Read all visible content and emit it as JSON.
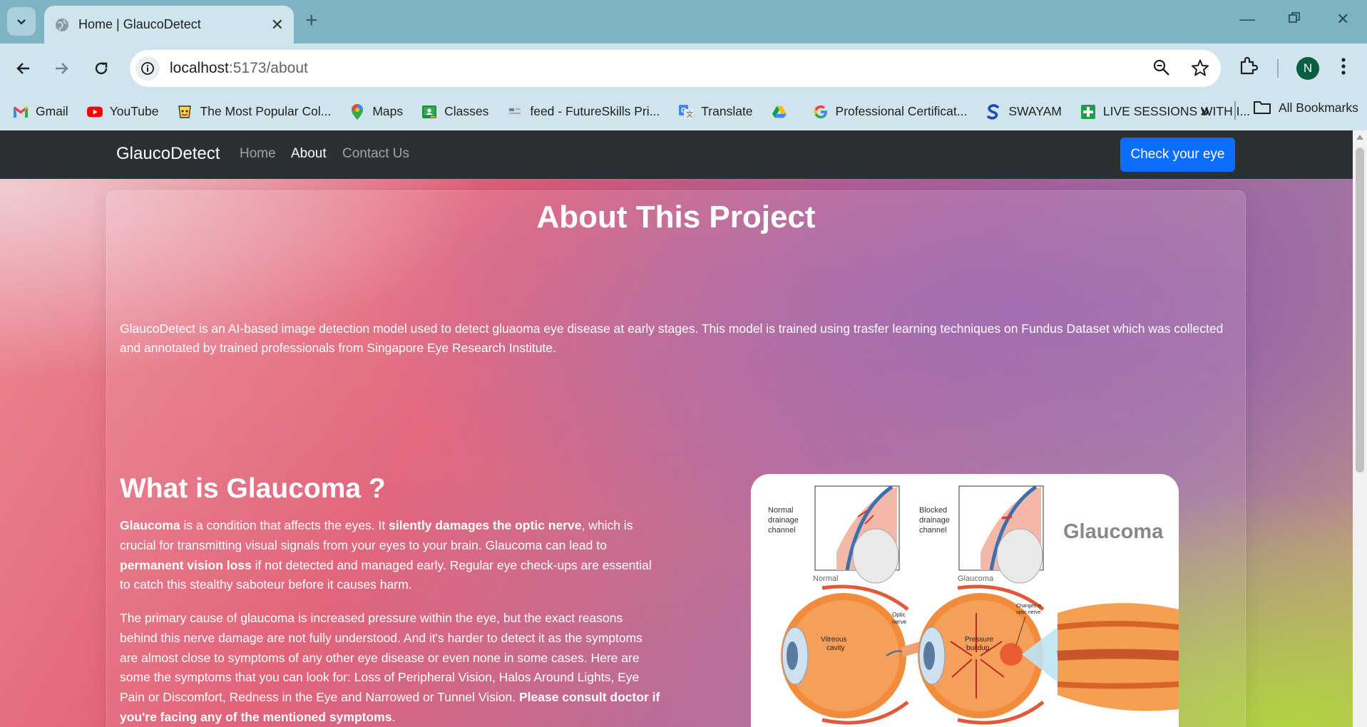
{
  "browser": {
    "tab_title": "Home | GlaucoDetect",
    "url_host": "localhost",
    "url_path": ":5173/about",
    "profile_initial": "N",
    "bookmarks": [
      {
        "label": "Gmail",
        "icon": "gmail-icon"
      },
      {
        "label": "YouTube",
        "icon": "youtube-icon"
      },
      {
        "label": "The Most Popular Col...",
        "icon": "cup-icon"
      },
      {
        "label": "Maps",
        "icon": "maps-pin-icon"
      },
      {
        "label": "Classes",
        "icon": "classroom-icon"
      },
      {
        "label": "feed - FutureSkills Pri...",
        "icon": "futureskills-icon"
      },
      {
        "label": "Translate",
        "icon": "translate-icon"
      },
      {
        "label": "",
        "icon": "google-drive-icon"
      },
      {
        "label": "Professional Certificat...",
        "icon": "google-g-icon"
      },
      {
        "label": "SWAYAM",
        "icon": "swayam-icon"
      },
      {
        "label": "LIVE SESSIONS WITH I...",
        "icon": "green-plus-icon"
      }
    ],
    "all_bookmarks": "All Bookmarks"
  },
  "nav": {
    "brand": "GlaucoDetect",
    "links": [
      "Home",
      "About",
      "Contact Us"
    ],
    "active": "About",
    "cta": "Check your eye"
  },
  "about": {
    "title": "About This Project",
    "description": "GlaucoDetect is an AI-based image detection model used to detect gluaoma eye disease at early stages. This model is trained using trasfer learning techniques on Fundus Dataset which was collected and annotated by trained professionals from Singapore Eye Research Institute."
  },
  "glaucoma": {
    "title": "What is Glaucoma ?",
    "p1": [
      {
        "t": "Glaucoma",
        "b": true
      },
      {
        "t": " is a condition that affects the eyes. It ",
        "b": false
      },
      {
        "t": "silently damages the optic nerve",
        "b": true
      },
      {
        "t": ", which is crucial for transmitting visual signals from your eyes to your brain. Glaucoma can lead to ",
        "b": false
      },
      {
        "t": "permanent vision loss",
        "b": true
      },
      {
        "t": " if not detected and managed early. Regular eye check-ups are essential to catch this stealthy saboteur before it causes harm.",
        "b": false
      }
    ],
    "p2": [
      {
        "t": "The primary cause of glaucoma is increased pressure within the eye, but the exact reasons behind this nerve damage are not fully understood. And it's harder to detect it as the symptoms are almost close to symptoms of any other eye disease or even none in some cases. Here are some the symptoms that you can look for: Loss of Peripheral Vision, Halos Around Lights, Eye Pain or Discomfort, Redness in the Eye and Narrowed or Tunnel Vision. ",
        "b": false
      },
      {
        "t": "Please consult doctor if you're facing any of the mentioned symptoms",
        "b": true
      },
      {
        "t": ".",
        "b": false
      }
    ]
  },
  "figure": {
    "heading": "Glaucoma",
    "normal_channel": [
      "Normal",
      "drainage",
      "channel"
    ],
    "blocked_channel": [
      "Blocked",
      "drainage",
      "channel"
    ],
    "caption_normal": "Normal",
    "caption_glaucoma": "Glaucoma",
    "vitreous": [
      "Vitreous",
      "cavity"
    ],
    "optic": [
      "Optic",
      "nerve"
    ],
    "pressure": [
      "Pressure",
      "buildup"
    ],
    "changes": [
      "Changes in",
      "optic nerve"
    ]
  },
  "colors": {
    "nav_bg": "#2b3035",
    "cta_bg": "#0d6efd",
    "chrome_bg": "#cfe4ec"
  }
}
